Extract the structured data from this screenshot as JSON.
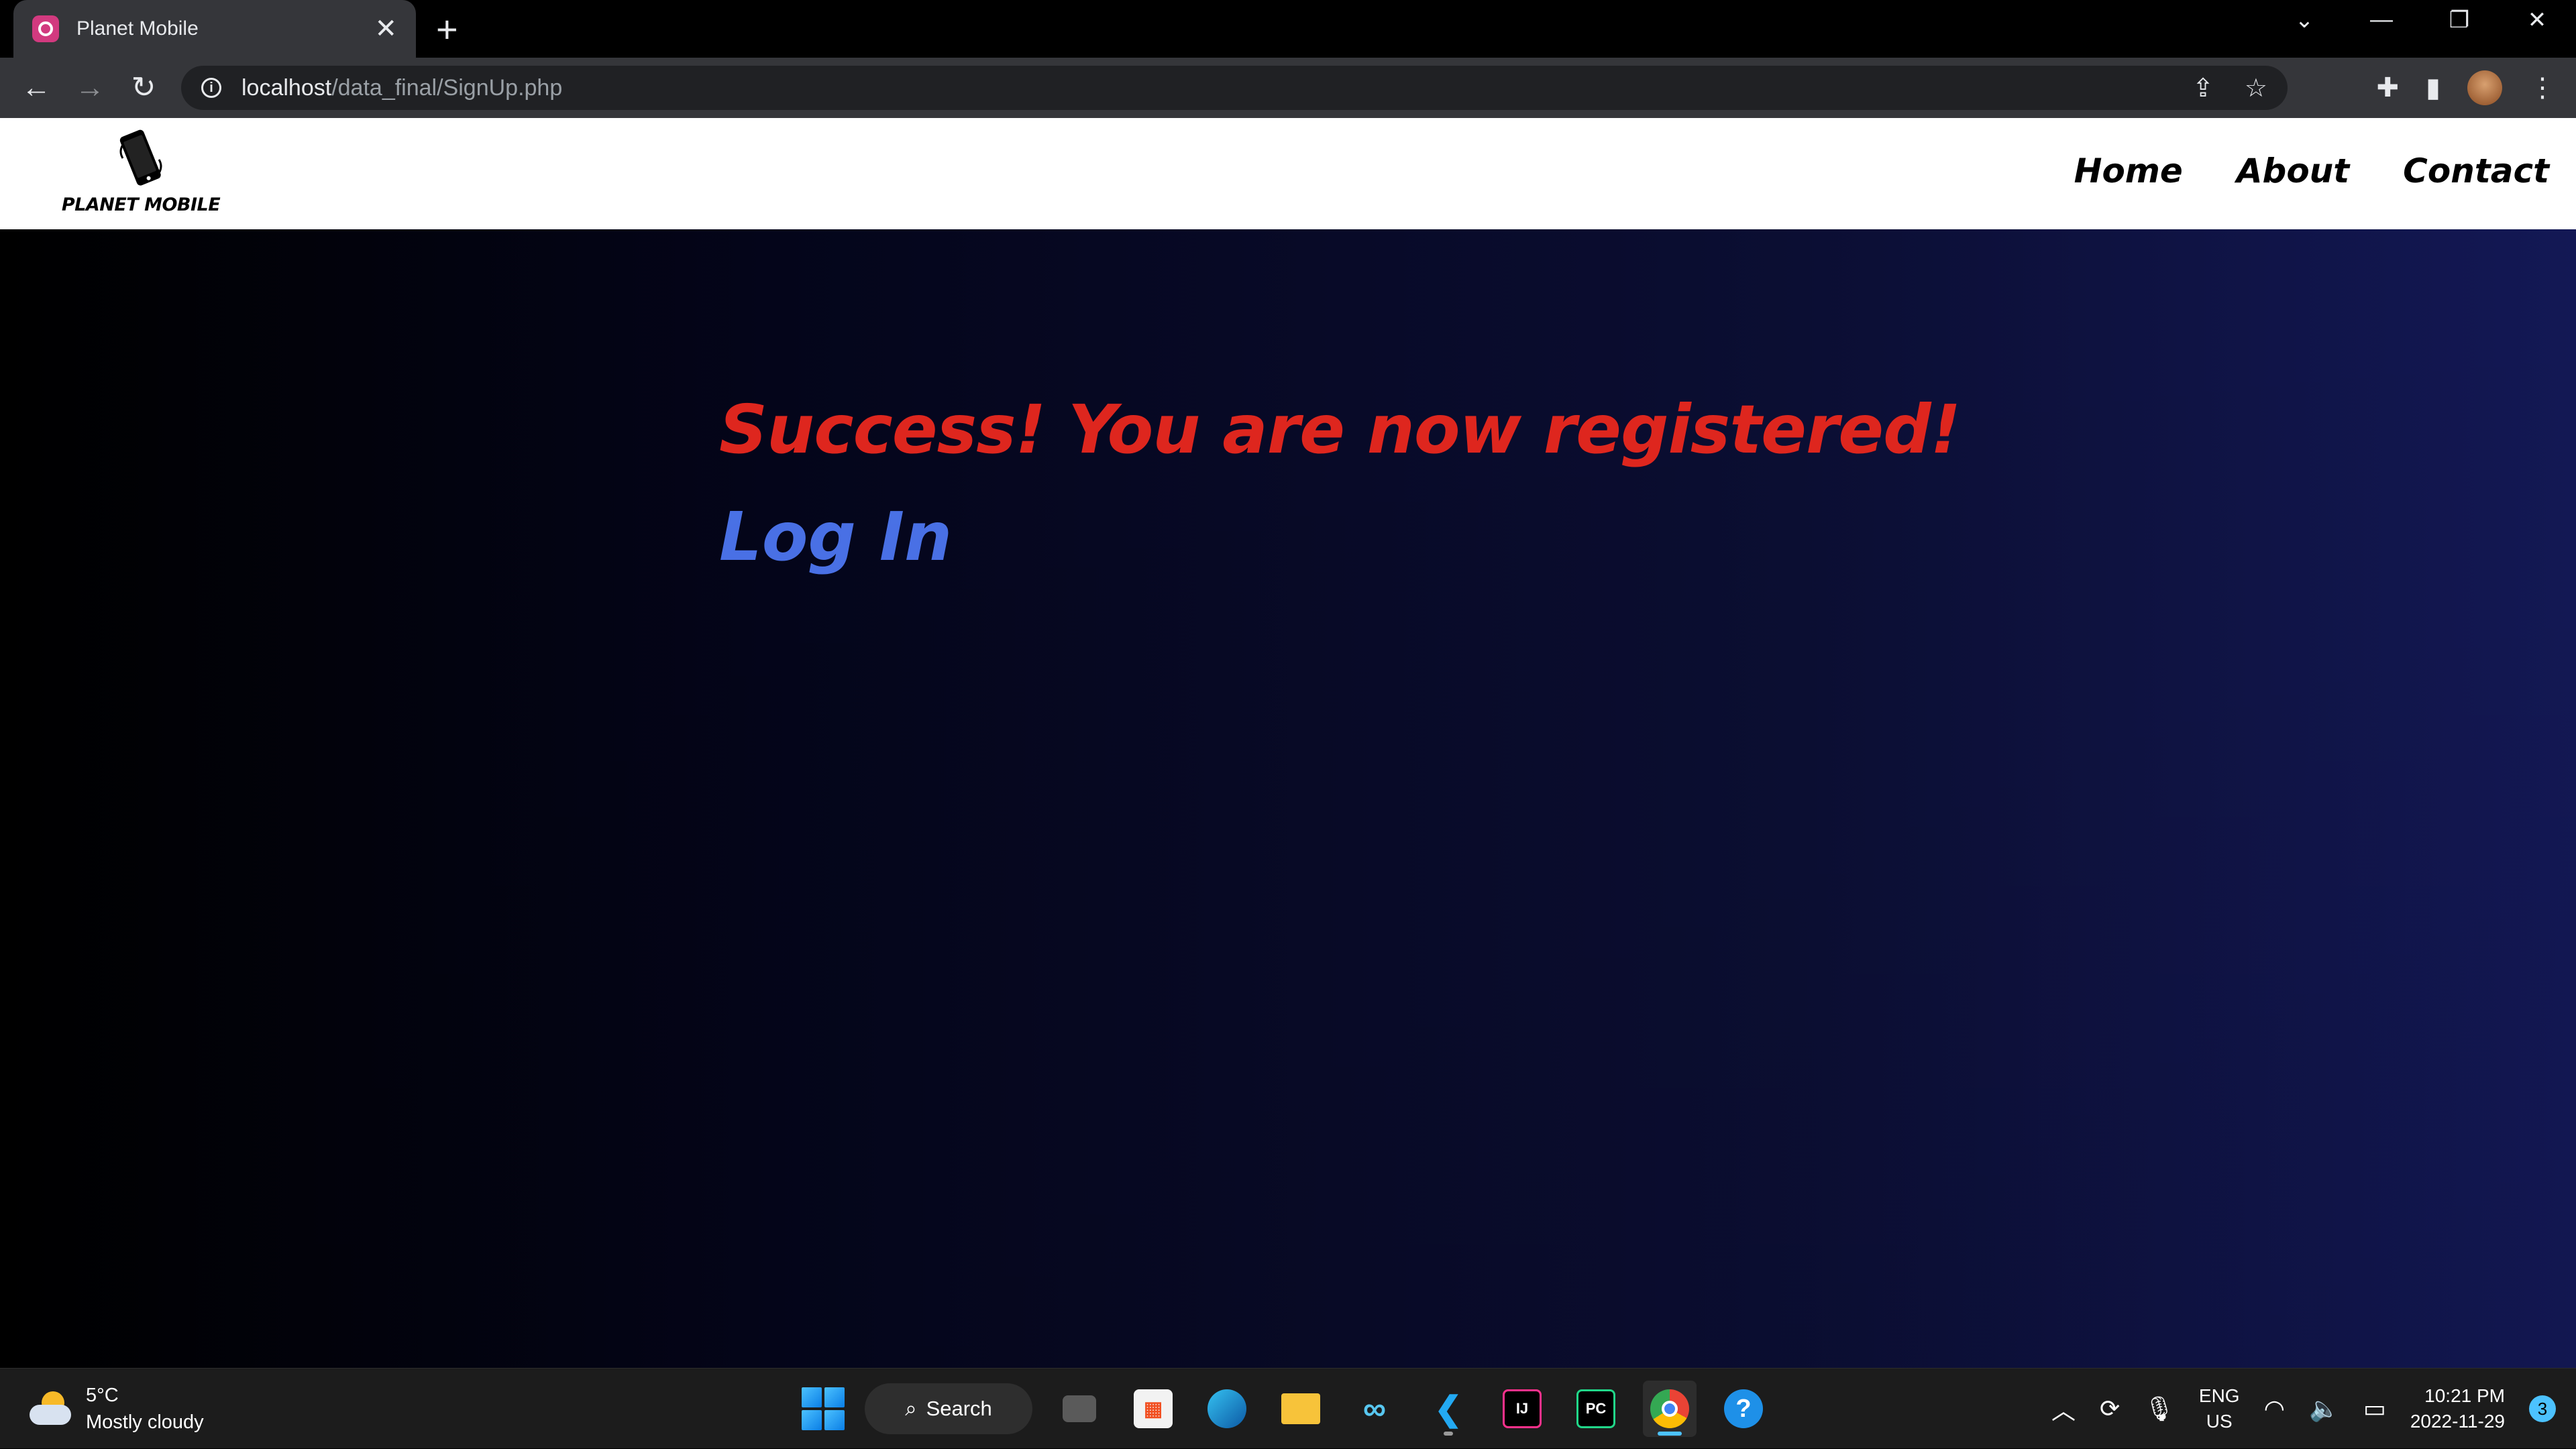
{
  "browser": {
    "tab_title": "Planet Mobile",
    "url_host": "localhost",
    "url_path": "/data_final/SignUp.php"
  },
  "site": {
    "logo_text": "PLANET MOBILE",
    "nav": [
      "Home",
      "About",
      "Contact"
    ]
  },
  "main": {
    "success_message": "Success! You are now registered!",
    "login_link": "Log In",
    "success_color": "#e0261e",
    "link_color": "#4a72e8"
  },
  "taskbar": {
    "weather_temp": "5°C",
    "weather_desc": "Mostly cloudy",
    "search_label": "Search",
    "lang_primary": "ENG",
    "lang_secondary": "US",
    "time": "10:21 PM",
    "date": "2022-11-29",
    "notification_count": "3"
  }
}
